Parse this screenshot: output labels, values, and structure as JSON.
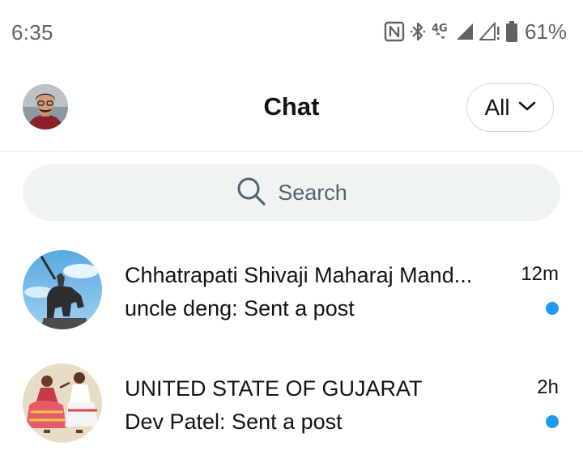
{
  "status_bar": {
    "time": "6:35",
    "battery_percent": "61%",
    "network": "4G",
    "icons": [
      "nfc-icon",
      "bluetooth-icon",
      "4g-icon",
      "signal-icon",
      "signal-no-data-icon",
      "battery-icon"
    ]
  },
  "header": {
    "title": "Chat",
    "filter_label": "All"
  },
  "search": {
    "placeholder": "Search"
  },
  "chats": [
    {
      "name": "Chhatrapati Shivaji Maharaj Mand...",
      "time": "12m",
      "preview": "uncle deng: Sent a post",
      "unread": true
    },
    {
      "name": "UNITED STATE OF GUJARAT",
      "time": "2h",
      "preview": "Dev Patel: Sent a post",
      "unread": true
    }
  ],
  "colors": {
    "accent": "#1d9bf0",
    "search_bg": "#eff3f4",
    "text": "#0f1419",
    "muted": "#536471"
  }
}
